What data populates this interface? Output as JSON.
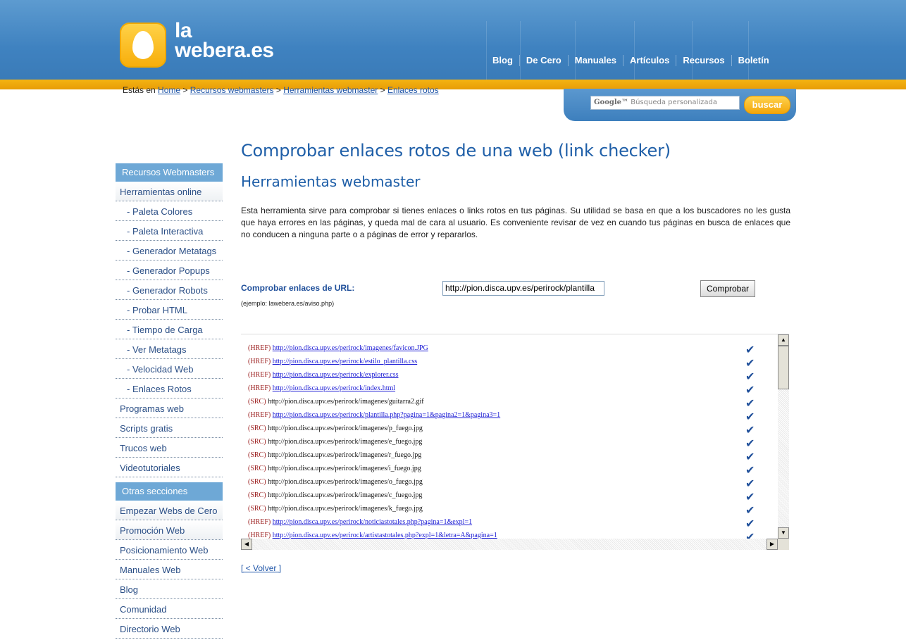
{
  "brand": {
    "line1": "la",
    "line2": "webera.es"
  },
  "topnav": [
    "Blog",
    "De Cero",
    "Manuales",
    "Artículos",
    "Recursos",
    "Boletín"
  ],
  "breadcrumb": {
    "prefix": "Estás en",
    "items": [
      "Home",
      "Recursos webmasters",
      "Herramientas webmaster",
      "Enlaces rotos"
    ],
    "separator": ">"
  },
  "search": {
    "google_label": "Google™",
    "placeholder": "Búsqueda personalizada",
    "button": "buscar"
  },
  "sidebar": {
    "section1_title": "Recursos Webmasters",
    "section1_items": [
      {
        "label": "Herramientas online",
        "sub": false,
        "gray": true
      },
      {
        "label": "- Paleta Colores",
        "sub": true,
        "gray": false
      },
      {
        "label": "- Paleta Interactiva",
        "sub": true,
        "gray": false
      },
      {
        "label": "- Generador Metatags",
        "sub": true,
        "gray": false
      },
      {
        "label": "- Generador Popups",
        "sub": true,
        "gray": false
      },
      {
        "label": "- Generador Robots",
        "sub": true,
        "gray": false
      },
      {
        "label": "- Probar HTML",
        "sub": true,
        "gray": false
      },
      {
        "label": "- Tiempo de Carga",
        "sub": true,
        "gray": false
      },
      {
        "label": "- Ver Metatags",
        "sub": true,
        "gray": false
      },
      {
        "label": "- Velocidad Web",
        "sub": true,
        "gray": false
      },
      {
        "label": "- Enlaces Rotos",
        "sub": true,
        "gray": false
      },
      {
        "label": "Programas web",
        "sub": false,
        "gray": false
      },
      {
        "label": "Scripts gratis",
        "sub": false,
        "gray": false
      },
      {
        "label": "Trucos web",
        "sub": false,
        "gray": false
      },
      {
        "label": "Videotutoriales",
        "sub": false,
        "gray": false
      }
    ],
    "section2_title": "Otras secciones",
    "section2_items": [
      {
        "label": "Empezar Webs de Cero",
        "gray": true
      },
      {
        "label": "Promoción Web",
        "gray": true
      },
      {
        "label": "Posicionamiento Web",
        "gray": false
      },
      {
        "label": "Manuales Web",
        "gray": false
      },
      {
        "label": "Blog",
        "gray": false
      },
      {
        "label": "Comunidad",
        "gray": false
      },
      {
        "label": "Directorio Web",
        "gray": false
      }
    ]
  },
  "main": {
    "title": "Comprobar enlaces rotos de una web (link checker)",
    "subtitle": "Herramientas webmaster",
    "intro": "Esta herramienta sirve para comprobar si tienes enlaces o links rotos en tus páginas. Su utilidad se basa en que a los buscadores no les gusta que haya errores en las páginas, y queda mal de cara al usuario. Es conveniente revisar de vez en cuando tus páginas en busca de enlaces que no conducen a ninguna parte o a páginas de error y repararlos.",
    "url_label": "Comprobar enlaces de URL:",
    "url_example": "(ejemplo: lawebera.es/aviso.php)",
    "url_value": "http://pion.disca.upv.es/perirock/plantilla",
    "url_button": "Comprobar",
    "back": "[ < Volver ]"
  },
  "results": [
    {
      "type": "(HREF)",
      "url": "http://pion.disca.upv.es/perirock/imagenes/favicon.JPG",
      "link": true,
      "ok": true
    },
    {
      "type": "(HREF)",
      "url": "http://pion.disca.upv.es/perirock/estilo_plantilla.css",
      "link": true,
      "ok": true
    },
    {
      "type": "(HREF)",
      "url": "http://pion.disca.upv.es/perirock/explorer.css",
      "link": true,
      "ok": true
    },
    {
      "type": "(HREF)",
      "url": "http://pion.disca.upv.es/perirock/index.html",
      "link": true,
      "ok": true
    },
    {
      "type": "(SRC)",
      "url": "http://pion.disca.upv.es/perirock/imagenes/guitarra2.gif",
      "link": false,
      "ok": true
    },
    {
      "type": "(HREF)",
      "url": "http://pion.disca.upv.es/perirock/plantilla.php?pagina=1&pagina2=1&pagina3=1",
      "link": true,
      "ok": true
    },
    {
      "type": "(SRC)",
      "url": "http://pion.disca.upv.es/perirock/imagenes/p_fuego.jpg",
      "link": false,
      "ok": true
    },
    {
      "type": "(SRC)",
      "url": "http://pion.disca.upv.es/perirock/imagenes/e_fuego.jpg",
      "link": false,
      "ok": true
    },
    {
      "type": "(SRC)",
      "url": "http://pion.disca.upv.es/perirock/imagenes/r_fuego.jpg",
      "link": false,
      "ok": true
    },
    {
      "type": "(SRC)",
      "url": "http://pion.disca.upv.es/perirock/imagenes/i_fuego.jpg",
      "link": false,
      "ok": true
    },
    {
      "type": "(SRC)",
      "url": "http://pion.disca.upv.es/perirock/imagenes/o_fuego.jpg",
      "link": false,
      "ok": true
    },
    {
      "type": "(SRC)",
      "url": "http://pion.disca.upv.es/perirock/imagenes/c_fuego.jpg",
      "link": false,
      "ok": true
    },
    {
      "type": "(SRC)",
      "url": "http://pion.disca.upv.es/perirock/imagenes/k_fuego.jpg",
      "link": false,
      "ok": true
    },
    {
      "type": "(HREF)",
      "url": "http://pion.disca.upv.es/perirock/noticiastotales.php?pagina=1&expl=1",
      "link": true,
      "ok": true
    },
    {
      "type": "(HREF)",
      "url": "http://pion.disca.upv.es/perirock/artistastotales.php?expl=1&letra=A&pagina=1",
      "link": true,
      "ok": true
    }
  ],
  "icons": {
    "check": "checkmark-icon",
    "scroll_up": "arrow-up-icon",
    "scroll_down": "arrow-down-icon",
    "scroll_left": "arrow-left-icon",
    "scroll_right": "arrow-right-icon"
  },
  "colors": {
    "header_blue": "#3f82c0",
    "accent_orange": "#f4b312",
    "link_blue": "#1f55a8",
    "title_blue": "#1f5fa8"
  }
}
